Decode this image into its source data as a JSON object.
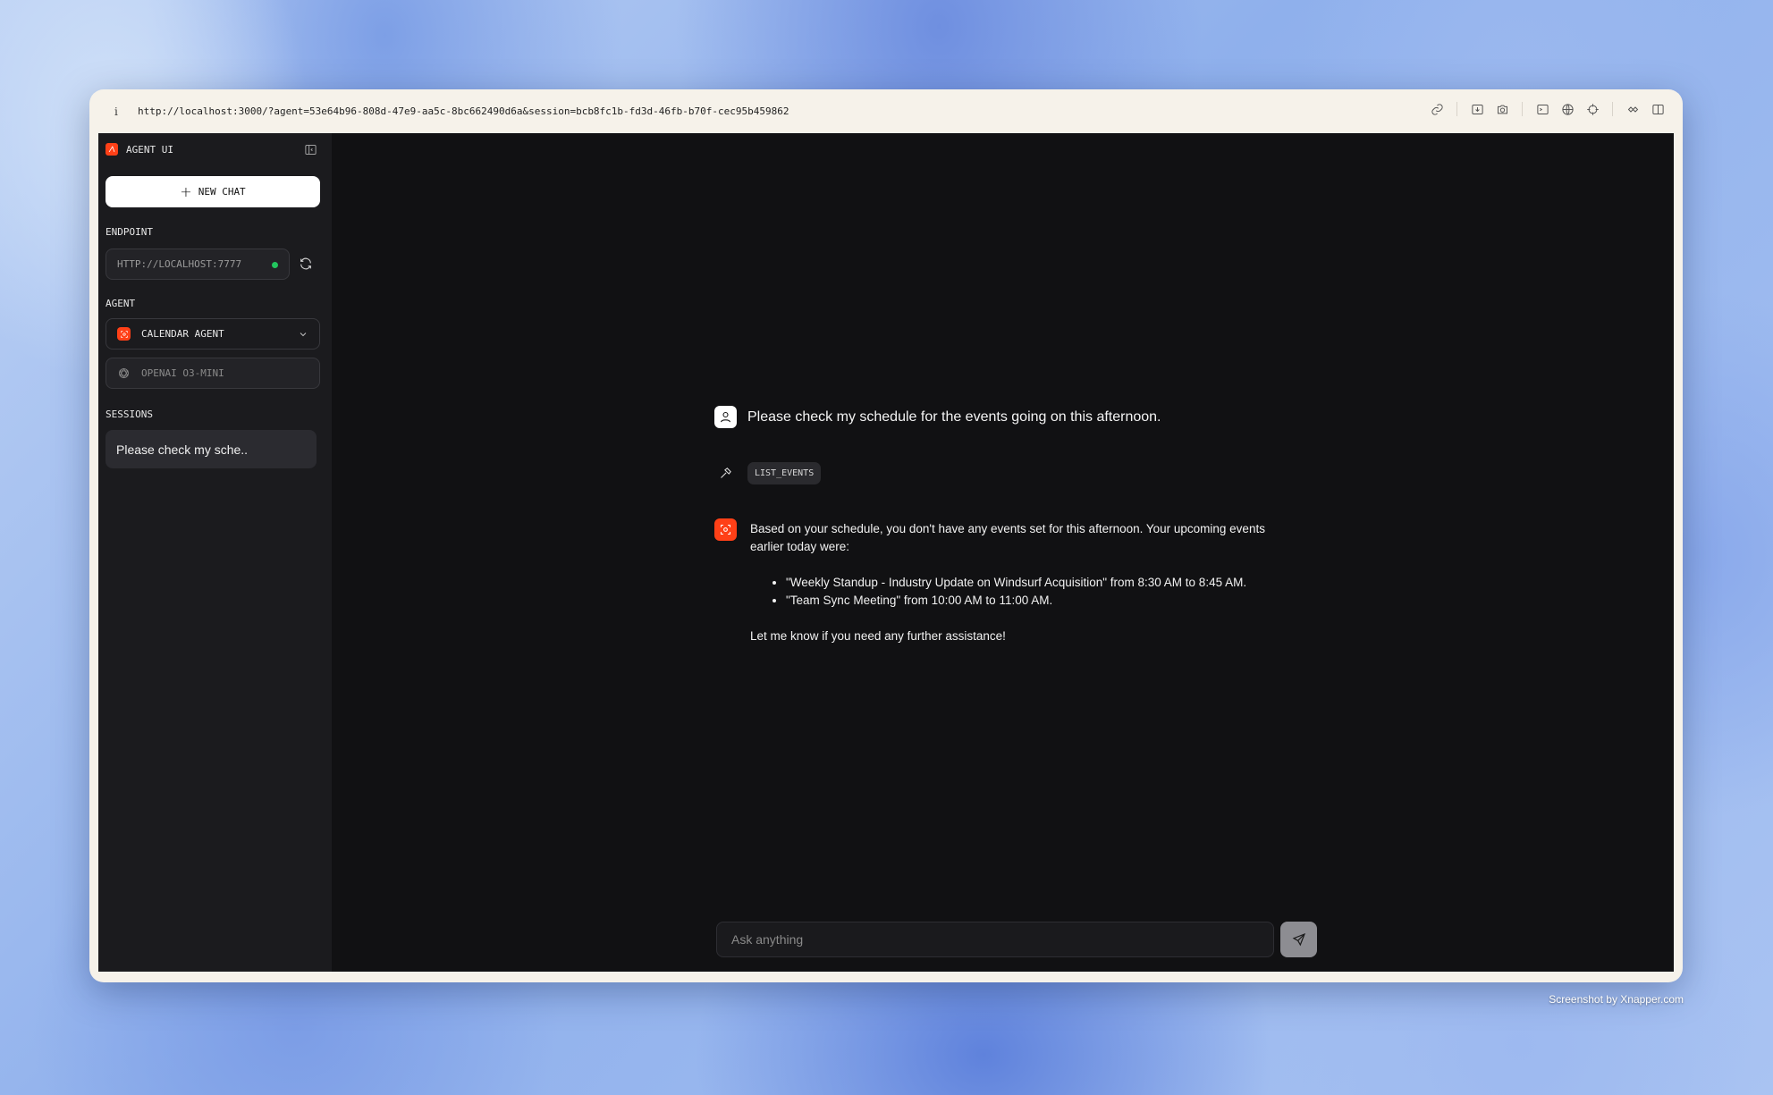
{
  "browser": {
    "url": "http://localhost:3000/?agent=53e64b96-808d-47e9-aa5c-8bc662490d6a&session=bcb8fc1b-fd3d-46fb-b70f-cec95b459862",
    "info_glyph": "i",
    "toolbar_icons": [
      "link-icon",
      "download-icon",
      "camera-icon",
      "terminal-icon",
      "globe-icon",
      "crosshair-icon",
      "extension-icon",
      "split-view-icon"
    ]
  },
  "sidebar": {
    "brand": "AGENT UI",
    "new_chat_label": "NEW CHAT",
    "endpoint": {
      "label": "ENDPOINT",
      "value": "HTTP://LOCALHOST:7777",
      "status_color": "#22c55e"
    },
    "agent": {
      "label": "AGENT",
      "selected": "CALENDAR AGENT",
      "model": "OPENAI O3-MINI"
    },
    "sessions": {
      "label": "SESSIONS",
      "items": [
        {
          "title": "Please check my sche.."
        }
      ]
    }
  },
  "chat": {
    "user_message": "Please check my schedule for the events going on this afternoon.",
    "tool_call": "LIST_EVENTS",
    "agent_message": {
      "intro": "Based on your schedule, you don't have any events set for this afternoon. Your upcoming events earlier today were:",
      "events": [
        "\"Weekly Standup - Industry Update on Windsurf Acquisition\" from 8:30 AM to 8:45 AM.",
        "\"Team Sync Meeting\" from 10:00 AM to 11:00 AM."
      ],
      "closing": "Let me know if you need any further assistance!"
    },
    "composer": {
      "placeholder": "Ask anything"
    }
  },
  "theme": {
    "accent": "#ff4017",
    "background": "#111113",
    "sidebar": "#1b1b1e"
  },
  "watermark": "Screenshot by Xnapper.com"
}
